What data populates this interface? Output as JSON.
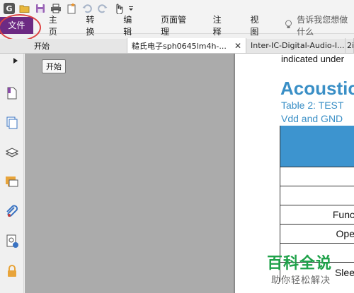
{
  "quick_access": {
    "icons": [
      "app-logo",
      "open-folder-icon",
      "save-icon",
      "print-icon",
      "new-icon",
      "undo-icon",
      "redo-icon",
      "hand-tool-icon",
      "customize-dropdown-icon"
    ],
    "logo_letter": "G"
  },
  "menubar": {
    "file_label": "文件",
    "items": [
      "主页",
      "转换",
      "编辑",
      "页面管理",
      "注释",
      "视图"
    ],
    "tell_me": "告诉我您想做什么"
  },
  "tabs": {
    "start": "开始",
    "doc1": "糙氏电子sph0645lm4h-...",
    "doc2": "Inter-IC-Digital-Audio-I...",
    "doc3": "2i"
  },
  "tooltip": "开始",
  "document": {
    "line_top": "indicated under",
    "heading": "Acoustic",
    "sub1": "Table 2: TEST",
    "sub2": "Vdd and GND",
    "rows": [
      "",
      "",
      "Func",
      "Ope",
      "",
      "Slee"
    ]
  },
  "watermark": {
    "title": "百科全说",
    "subtitle": "助你轻松解决"
  },
  "colors": {
    "file_menu": "#6d2a83",
    "heading_blue": "#3a8fc6",
    "table_header": "#3d94cf",
    "watermark_green": "#1fa24a"
  }
}
